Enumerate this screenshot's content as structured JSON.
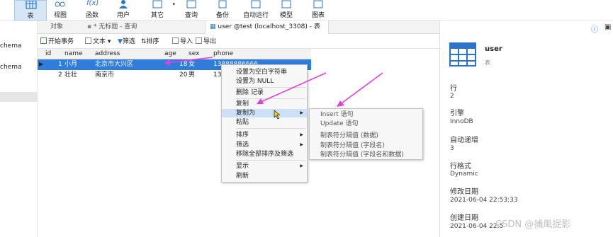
{
  "toolbar": {
    "items": [
      {
        "label": "表",
        "icon": "table-icon"
      },
      {
        "label": "视图",
        "icon": "view-icon"
      },
      {
        "label": "函数",
        "icon": "function-icon"
      },
      {
        "label": "用户",
        "icon": "user-icon"
      },
      {
        "label": "其它",
        "icon": "other-icon"
      },
      {
        "label": "查询",
        "icon": "query-icon"
      },
      {
        "label": "备份",
        "icon": "backup-icon"
      },
      {
        "label": "自动运行",
        "icon": "autorun-icon"
      },
      {
        "label": "模型",
        "icon": "model-icon"
      },
      {
        "label": "图表",
        "icon": "chart-icon"
      }
    ]
  },
  "sidebar": {
    "items": [
      "chema",
      "chema"
    ]
  },
  "tabs": [
    {
      "label": "对象"
    },
    {
      "label": "* 无标题 - 查询"
    },
    {
      "label": "user @test (localhost_3308) - 表"
    }
  ],
  "subtoolbar": {
    "begin_tx": "开始事务",
    "text": "文本",
    "filter": "筛选",
    "sort": "排序",
    "import": "导入",
    "export": "导出"
  },
  "grid": {
    "columns": [
      "id",
      "name",
      "address",
      "age",
      "sex",
      "phone"
    ],
    "rows": [
      {
        "id": "1",
        "name": "小月",
        "address": "北京市大兴区",
        "age": "18",
        "sex": "女",
        "phone": "13888886666"
      },
      {
        "id": "2",
        "name": "壮壮",
        "address": "南京市",
        "age": "20",
        "sex": "男",
        "phone": "13"
      }
    ]
  },
  "context_menu": {
    "items": [
      "设置为空白字符串",
      "设置为 NULL",
      "删除 记录",
      "复制",
      "复制为",
      "粘贴",
      "排序",
      "筛选",
      "移除全部排序及筛选",
      "显示",
      "刷新"
    ]
  },
  "submenu": {
    "items": [
      "Insert 语句",
      "Update 语句",
      "制表符分隔值 (数据)",
      "制表符分隔值 (字段名)",
      "制表符分隔值 (字段名和数据)"
    ]
  },
  "info": {
    "name": "user",
    "type": "表",
    "fields": [
      {
        "label": "行",
        "value": "2"
      },
      {
        "label": "引擎",
        "value": "InnoDB"
      },
      {
        "label": "自动递增",
        "value": "3"
      },
      {
        "label": "行格式",
        "value": "Dynamic"
      },
      {
        "label": "修改日期",
        "value": "2021-06-04 22:53:33"
      },
      {
        "label": "创建日期",
        "value": "2021-06-04 22:5"
      }
    ]
  },
  "watermark": "CSDN @捕風捉影",
  "colors": {
    "selection": "#2f7cd9",
    "arrow": "#e040e0",
    "accent": "#1a73c8"
  }
}
